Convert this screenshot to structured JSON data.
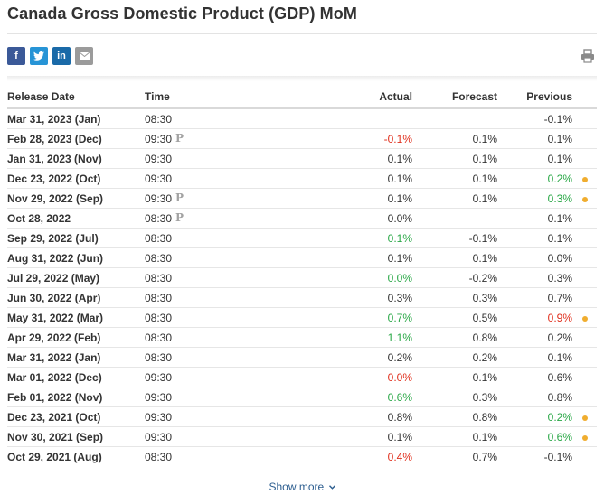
{
  "title": "Canada Gross Domestic Product (GDP) MoM",
  "share": {
    "buttons": [
      {
        "name": "facebook-share-button",
        "glyph": "f",
        "icon": "facebook-icon"
      },
      {
        "name": "twitter-share-button",
        "glyph": "t",
        "icon": "twitter-icon"
      },
      {
        "name": "linkedin-share-button",
        "glyph": "in",
        "icon": "linkedin-icon"
      },
      {
        "name": "email-share-button",
        "glyph": "✉",
        "icon": "email-icon"
      }
    ],
    "print_icon": "print-icon"
  },
  "columns": {
    "release_date": "Release Date",
    "time": "Time",
    "actual": "Actual",
    "forecast": "Forecast",
    "previous": "Previous"
  },
  "prelim_mark": "P",
  "colors": {
    "negative": "#e0301e",
    "positive": "#28a745",
    "revised_dot": "#f0ad2f",
    "link": "#2c5d8f"
  },
  "rows": [
    {
      "date": "Mar 31, 2023 (Jan)",
      "time": "08:30",
      "prelim": false,
      "actual": "",
      "actual_color": "neu",
      "forecast": "",
      "previous": "-0.1%",
      "previous_color": "neu",
      "revised": false
    },
    {
      "date": "Feb 28, 2023 (Dec)",
      "time": "09:30",
      "prelim": true,
      "actual": "-0.1%",
      "actual_color": "neg",
      "forecast": "0.1%",
      "previous": "0.1%",
      "previous_color": "neu",
      "revised": false
    },
    {
      "date": "Jan 31, 2023 (Nov)",
      "time": "09:30",
      "prelim": false,
      "actual": "0.1%",
      "actual_color": "neu",
      "forecast": "0.1%",
      "previous": "0.1%",
      "previous_color": "neu",
      "revised": false
    },
    {
      "date": "Dec 23, 2022 (Oct)",
      "time": "09:30",
      "prelim": false,
      "actual": "0.1%",
      "actual_color": "neu",
      "forecast": "0.1%",
      "previous": "0.2%",
      "previous_color": "pos",
      "revised": true
    },
    {
      "date": "Nov 29, 2022 (Sep)",
      "time": "09:30",
      "prelim": true,
      "actual": "0.1%",
      "actual_color": "neu",
      "forecast": "0.1%",
      "previous": "0.3%",
      "previous_color": "pos",
      "revised": true
    },
    {
      "date": "Oct 28, 2022",
      "time": "08:30",
      "prelim": true,
      "actual": "0.0%",
      "actual_color": "neu",
      "forecast": "",
      "previous": "0.1%",
      "previous_color": "neu",
      "revised": false
    },
    {
      "date": "Sep 29, 2022 (Jul)",
      "time": "08:30",
      "prelim": false,
      "actual": "0.1%",
      "actual_color": "pos",
      "forecast": "-0.1%",
      "previous": "0.1%",
      "previous_color": "neu",
      "revised": false
    },
    {
      "date": "Aug 31, 2022 (Jun)",
      "time": "08:30",
      "prelim": false,
      "actual": "0.1%",
      "actual_color": "neu",
      "forecast": "0.1%",
      "previous": "0.0%",
      "previous_color": "neu",
      "revised": false
    },
    {
      "date": "Jul 29, 2022 (May)",
      "time": "08:30",
      "prelim": false,
      "actual": "0.0%",
      "actual_color": "pos",
      "forecast": "-0.2%",
      "previous": "0.3%",
      "previous_color": "neu",
      "revised": false
    },
    {
      "date": "Jun 30, 2022 (Apr)",
      "time": "08:30",
      "prelim": false,
      "actual": "0.3%",
      "actual_color": "neu",
      "forecast": "0.3%",
      "previous": "0.7%",
      "previous_color": "neu",
      "revised": false
    },
    {
      "date": "May 31, 2022 (Mar)",
      "time": "08:30",
      "prelim": false,
      "actual": "0.7%",
      "actual_color": "pos",
      "forecast": "0.5%",
      "previous": "0.9%",
      "previous_color": "neg",
      "revised": true
    },
    {
      "date": "Apr 29, 2022 (Feb)",
      "time": "08:30",
      "prelim": false,
      "actual": "1.1%",
      "actual_color": "pos",
      "forecast": "0.8%",
      "previous": "0.2%",
      "previous_color": "neu",
      "revised": false
    },
    {
      "date": "Mar 31, 2022 (Jan)",
      "time": "08:30",
      "prelim": false,
      "actual": "0.2%",
      "actual_color": "neu",
      "forecast": "0.2%",
      "previous": "0.1%",
      "previous_color": "neu",
      "revised": false
    },
    {
      "date": "Mar 01, 2022 (Dec)",
      "time": "09:30",
      "prelim": false,
      "actual": "0.0%",
      "actual_color": "neg",
      "forecast": "0.1%",
      "previous": "0.6%",
      "previous_color": "neu",
      "revised": false
    },
    {
      "date": "Feb 01, 2022 (Nov)",
      "time": "09:30",
      "prelim": false,
      "actual": "0.6%",
      "actual_color": "pos",
      "forecast": "0.3%",
      "previous": "0.8%",
      "previous_color": "neu",
      "revised": false
    },
    {
      "date": "Dec 23, 2021 (Oct)",
      "time": "09:30",
      "prelim": false,
      "actual": "0.8%",
      "actual_color": "neu",
      "forecast": "0.8%",
      "previous": "0.2%",
      "previous_color": "pos",
      "revised": true
    },
    {
      "date": "Nov 30, 2021 (Sep)",
      "time": "09:30",
      "prelim": false,
      "actual": "0.1%",
      "actual_color": "neu",
      "forecast": "0.1%",
      "previous": "0.6%",
      "previous_color": "pos",
      "revised": true
    },
    {
      "date": "Oct 29, 2021 (Aug)",
      "time": "08:30",
      "prelim": false,
      "actual": "0.4%",
      "actual_color": "neg",
      "forecast": "0.7%",
      "previous": "-0.1%",
      "previous_color": "neu",
      "revised": false
    }
  ],
  "show_more": {
    "label": "Show more",
    "icon": "chevron-down-icon"
  }
}
